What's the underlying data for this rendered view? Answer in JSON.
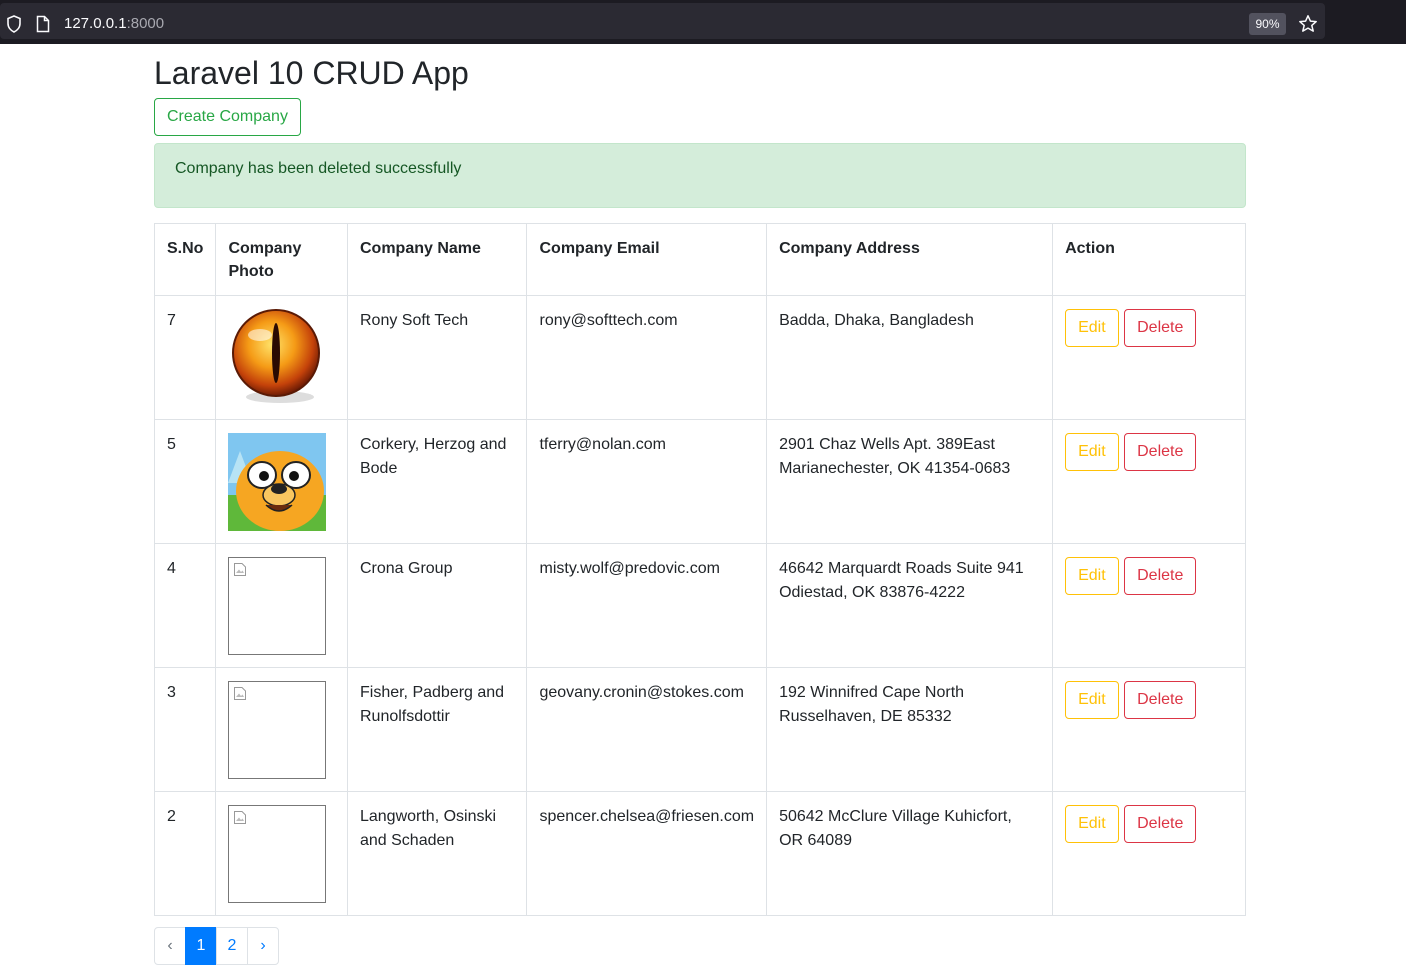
{
  "browser": {
    "url_host": "127.0.0.1",
    "url_port": ":8000",
    "zoom": "90%"
  },
  "page": {
    "title": "Laravel 10 CRUD App",
    "create_button": "Create Company",
    "alert_message": "Company has been deleted successfully"
  },
  "table": {
    "headers": {
      "sno": "S.No",
      "photo_line1": "Company",
      "photo_line2": "Photo",
      "name": "Company Name",
      "email": "Company Email",
      "address": "Company Address",
      "action": "Action"
    },
    "rows": [
      {
        "sno": "7",
        "photo": "cat-eye",
        "name": "Rony Soft Tech",
        "email": "rony@softtech.com",
        "address": "Badda, Dhaka, Bangladesh",
        "edit": "Edit",
        "delete": "Delete"
      },
      {
        "sno": "5",
        "photo": "jake-dog",
        "name": "Corkery, Herzog and Bode",
        "email": "tferry@nolan.com",
        "address": "2901 Chaz Wells Apt. 389East Marianechester, OK 41354-0683",
        "edit": "Edit",
        "delete": "Delete"
      },
      {
        "sno": "4",
        "photo": "broken-image",
        "name": "Crona Group",
        "email": "misty.wolf@predovic.com",
        "address": "46642 Marquardt Roads Suite 941 Odiestad, OK 83876-4222",
        "edit": "Edit",
        "delete": "Delete"
      },
      {
        "sno": "3",
        "photo": "broken-image",
        "name": "Fisher, Padberg and Runolfsdottir",
        "email": "geovany.cronin@stokes.com",
        "address": "192 Winnifred Cape North Russelhaven, DE 85332",
        "edit": "Edit",
        "delete": "Delete"
      },
      {
        "sno": "2",
        "photo": "broken-image",
        "name": "Langworth, Osinski and Schaden",
        "email": "spencer.chelsea@friesen.com",
        "address": "50642 McClure Village Kuhicfort, OR 64089",
        "edit": "Edit",
        "delete": "Delete"
      }
    ]
  },
  "pagination": {
    "prev": "‹",
    "pages": [
      "1",
      "2"
    ],
    "active": "1",
    "next": "›"
  },
  "colors": {
    "success": "#28a745",
    "warning": "#ffc107",
    "danger": "#dc3545",
    "primary": "#007bff",
    "alert_bg": "#d4edda"
  },
  "icons": {
    "shield": "shield-icon",
    "page": "page-icon",
    "star": "bookmark-star-icon",
    "broken_image": "broken-image-icon"
  }
}
